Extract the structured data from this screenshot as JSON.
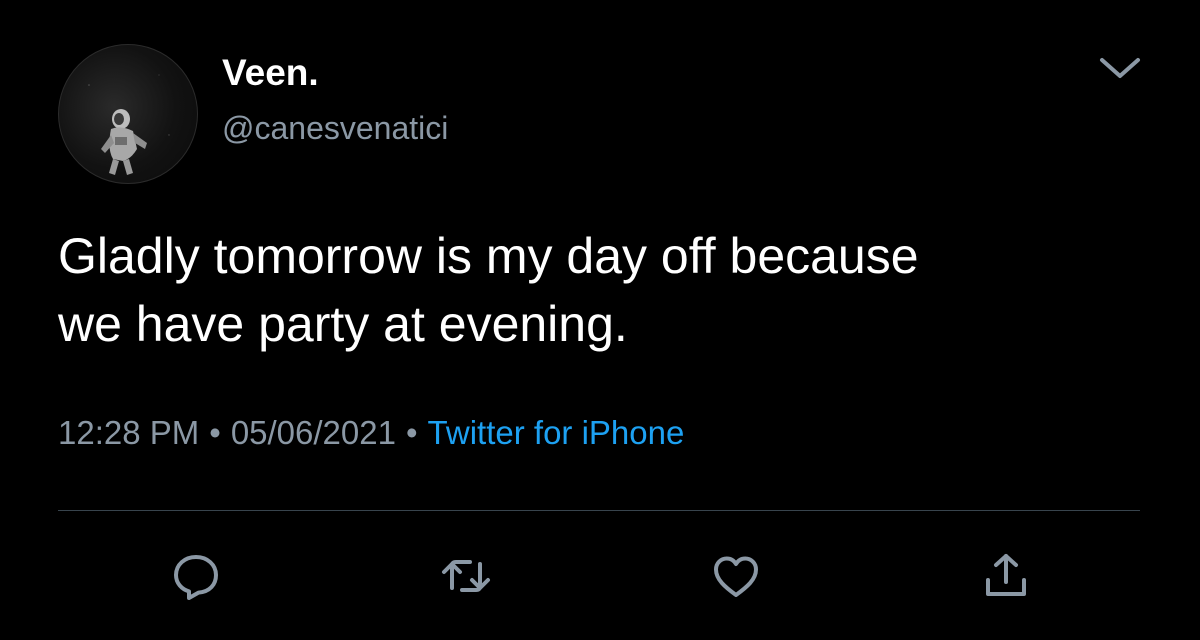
{
  "user": {
    "display_name": "Veen.",
    "handle": "@canesvenatici",
    "avatar_icon": "astronaut-avatar"
  },
  "tweet": {
    "text": "Gladly tomorrow is my day off because\nwe have party at evening.",
    "time": "12:28 PM",
    "date": "05/06/2021",
    "separator": "•",
    "source": "Twitter for iPhone"
  },
  "actions": {
    "reply_icon": "reply-icon",
    "retweet_icon": "retweet-icon",
    "like_icon": "heart-icon",
    "share_icon": "share-icon"
  },
  "colors": {
    "background": "#000000",
    "text_primary": "#ffffff",
    "text_secondary": "#8b98a5",
    "link": "#1da1f2",
    "divider": "#38444d",
    "icon": "#8b98a5"
  }
}
